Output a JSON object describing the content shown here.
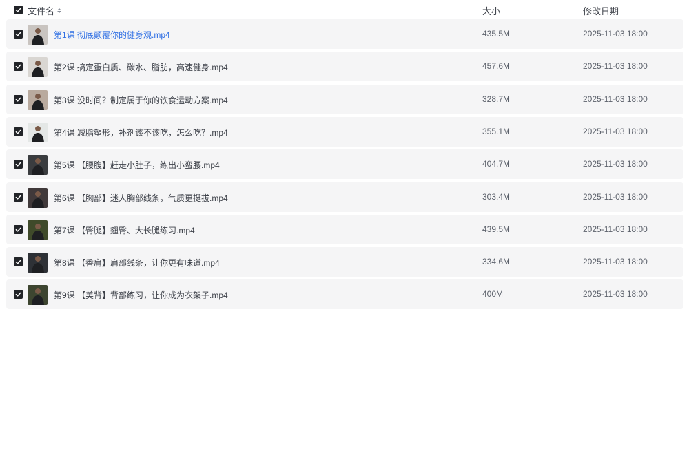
{
  "header": {
    "name_label": "文件名",
    "size_label": "大小",
    "date_label": "修改日期",
    "select_all_checked": true
  },
  "files": [
    {
      "name": "第1课 彻底颠覆你的健身观.mp4",
      "size": "435.5M",
      "date": "2025-11-03 18:00",
      "checked": true,
      "active": true,
      "thumb_bg": "#c9c4c0"
    },
    {
      "name": "第2课 搞定蛋白质、碳水、脂肪，高速健身.mp4",
      "size": "457.6M",
      "date": "2025-11-03 18:00",
      "checked": true,
      "active": false,
      "thumb_bg": "#d9d6d2"
    },
    {
      "name": "第3课 没时间？制定属于你的饮食运动方案.mp4",
      "size": "328.7M",
      "date": "2025-11-03 18:00",
      "checked": true,
      "active": false,
      "thumb_bg": "#b9aa9e"
    },
    {
      "name": "第4课 减脂塑形，补剂该不该吃，怎么吃？.mp4",
      "size": "355.1M",
      "date": "2025-11-03 18:00",
      "checked": true,
      "active": false,
      "thumb_bg": "#e4e7e6"
    },
    {
      "name": "第5课 【腰腹】赶走小肚子，练出小蛮腰.mp4",
      "size": "404.7M",
      "date": "2025-11-03 18:00",
      "checked": true,
      "active": false,
      "thumb_bg": "#3a3c3f"
    },
    {
      "name": "第6课 【胸部】迷人胸部线条，气质更挺拔.mp4",
      "size": "303.4M",
      "date": "2025-11-03 18:00",
      "checked": true,
      "active": false,
      "thumb_bg": "#40393a"
    },
    {
      "name": "第7课 【臀腿】翘臀、大长腿练习.mp4",
      "size": "439.5M",
      "date": "2025-11-03 18:00",
      "checked": true,
      "active": false,
      "thumb_bg": "#3f4a2a"
    },
    {
      "name": "第8课 【香肩】肩部线条，让你更有味道.mp4",
      "size": "334.6M",
      "date": "2025-11-03 18:00",
      "checked": true,
      "active": false,
      "thumb_bg": "#2e3136"
    },
    {
      "name": "第9课 【美背】背部练习，让你成为衣架子.mp4",
      "size": "400M",
      "date": "2025-11-03 18:00",
      "checked": true,
      "active": false,
      "thumb_bg": "#3d4530"
    }
  ]
}
